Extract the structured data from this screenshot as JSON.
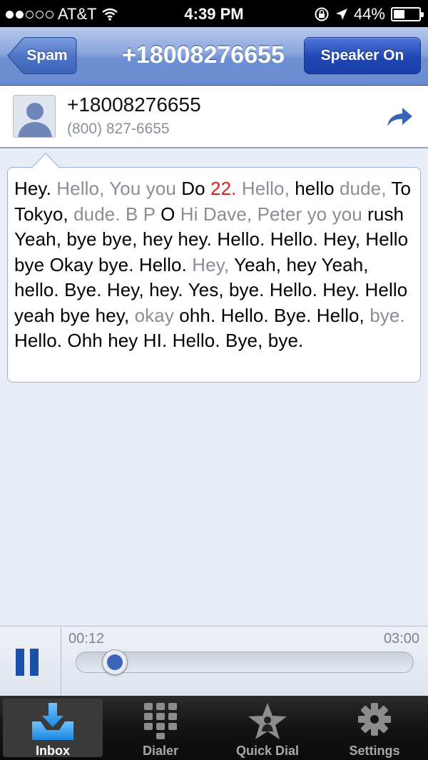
{
  "status_bar": {
    "carrier": "AT&T",
    "time": "4:39 PM",
    "battery": "44%",
    "battery_fraction": 0.44
  },
  "nav": {
    "back_label": "Spam",
    "title": "+18008276655",
    "speaker_label": "Speaker On"
  },
  "contact": {
    "name": "+18008276655",
    "number": "(800) 827-6655"
  },
  "transcript": {
    "words": [
      {
        "t": "Hey.",
        "c": "hi"
      },
      {
        "t": "Hello,",
        "c": "low"
      },
      {
        "t": "You",
        "c": "low"
      },
      {
        "t": "you",
        "c": "low"
      },
      {
        "t": "Do",
        "c": "hi"
      },
      {
        "t": "22.",
        "c": "red"
      },
      {
        "t": "Hello,",
        "c": "low"
      },
      {
        "t": "hello",
        "c": "hi"
      },
      {
        "t": "dude,",
        "c": "low"
      },
      {
        "t": "To",
        "c": "hi"
      },
      {
        "t": "Tokyo,",
        "c": "hi"
      },
      {
        "t": "dude.",
        "c": "low"
      },
      {
        "t": "B",
        "c": "low"
      },
      {
        "t": "P",
        "c": "low"
      },
      {
        "t": "O",
        "c": "hi"
      },
      {
        "t": "Hi",
        "c": "low"
      },
      {
        "t": "Dave,",
        "c": "low"
      },
      {
        "t": "Peter",
        "c": "low"
      },
      {
        "t": "yo",
        "c": "low"
      },
      {
        "t": "you",
        "c": "low"
      },
      {
        "t": "rush",
        "c": "hi"
      },
      {
        "t": "Yeah,",
        "c": "hi"
      },
      {
        "t": "bye",
        "c": "hi"
      },
      {
        "t": "bye,",
        "c": "hi"
      },
      {
        "t": "hey",
        "c": "hi"
      },
      {
        "t": "hey.",
        "c": "hi"
      },
      {
        "t": "Hello.",
        "c": "hi"
      },
      {
        "t": "Hello.",
        "c": "hi"
      },
      {
        "t": "Hey,",
        "c": "hi"
      },
      {
        "t": "Hello",
        "c": "hi"
      },
      {
        "t": "bye",
        "c": "hi"
      },
      {
        "t": "Okay",
        "c": "hi"
      },
      {
        "t": "bye.",
        "c": "hi"
      },
      {
        "t": "Hello.",
        "c": "hi"
      },
      {
        "t": "Hey,",
        "c": "low"
      },
      {
        "t": "Yeah,",
        "c": "hi"
      },
      {
        "t": "hey",
        "c": "hi"
      },
      {
        "t": "Yeah,",
        "c": "hi"
      },
      {
        "t": "hello.",
        "c": "hi"
      },
      {
        "t": "Bye.",
        "c": "hi"
      },
      {
        "t": "Hey,",
        "c": "hi"
      },
      {
        "t": "hey.",
        "c": "hi"
      },
      {
        "t": "Yes,",
        "c": "hi"
      },
      {
        "t": "bye.",
        "c": "hi"
      },
      {
        "t": "Hello.",
        "c": "hi"
      },
      {
        "t": "Hey.",
        "c": "hi"
      },
      {
        "t": "Hello",
        "c": "hi"
      },
      {
        "t": "yeah",
        "c": "hi"
      },
      {
        "t": "bye",
        "c": "hi"
      },
      {
        "t": "hey,",
        "c": "hi"
      },
      {
        "t": "okay",
        "c": "low"
      },
      {
        "t": "ohh.",
        "c": "hi"
      },
      {
        "t": "Hello.",
        "c": "hi"
      },
      {
        "t": "Bye.",
        "c": "hi"
      },
      {
        "t": "Hello,",
        "c": "hi"
      },
      {
        "t": "bye.",
        "c": "low"
      },
      {
        "t": "Hello.",
        "c": "hi"
      },
      {
        "t": "Ohh",
        "c": "hi"
      },
      {
        "t": "hey",
        "c": "hi"
      },
      {
        "t": "HI.",
        "c": "hi"
      },
      {
        "t": "Hello.",
        "c": "hi"
      },
      {
        "t": "Bye,",
        "c": "hi"
      },
      {
        "t": "bye.",
        "c": "hi"
      }
    ]
  },
  "player": {
    "current_time": "00:12",
    "total_time": "03:00",
    "progress_fraction": 0.067
  },
  "tabs": [
    {
      "label": "Inbox",
      "icon": "inbox-download-icon",
      "active": true
    },
    {
      "label": "Dialer",
      "icon": "keypad-icon",
      "active": false
    },
    {
      "label": "Quick Dial",
      "icon": "star-person-icon",
      "active": false
    },
    {
      "label": "Settings",
      "icon": "gear-icon",
      "active": false
    }
  ],
  "colors": {
    "accent_blue": "#1b4fa8",
    "low_confidence_text": "#8a8d93",
    "number_highlight": "#e0201c"
  }
}
